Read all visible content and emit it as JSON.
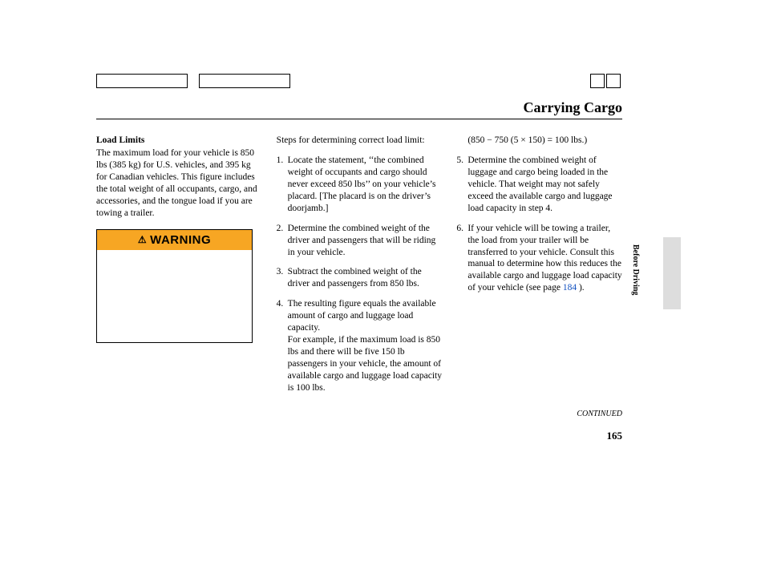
{
  "header": {
    "title": "Carrying Cargo"
  },
  "col1": {
    "subheading": "Load Limits",
    "para1": "The maximum load for your vehicle is 850 lbs (385 kg) for U.S. vehicles, and 395 kg for Canadian vehicles. This figure includes the total weight of all occupants, cargo, and accessories, and the tongue load if you are towing a trailer.",
    "warning_label": "WARNING"
  },
  "col2": {
    "intro": "Steps for determining correct load limit:",
    "items": [
      {
        "num": "1.",
        "text": "Locate the statement, ‘‘the combined weight of occupants and cargo should never exceed 850 lbs’’ on your vehicle’s placard. [The placard is on the driver’s doorjamb.]"
      },
      {
        "num": "2.",
        "text": "Determine the combined weight of the driver and passengers that will be riding in your vehicle."
      },
      {
        "num": "3.",
        "text": "Subtract the combined weight of the driver and passengers from 850 lbs."
      },
      {
        "num": "4.",
        "text": "The resulting figure equals the available amount of cargo and luggage load capacity.\nFor example, if the maximum load is 850 lbs and there will be five 150 lb passengers in your vehicle, the amount of available cargo and luggage load capacity is 100 lbs."
      }
    ]
  },
  "col3": {
    "calc": "(850 − 750 (5 × 150) = 100 lbs.)",
    "items": [
      {
        "num": "5.",
        "text": "Determine the combined weight of luggage and cargo being loaded in the vehicle. That weight may not safely exceed the available cargo and luggage load capacity in step 4."
      },
      {
        "num": "6.",
        "text_pre": "If your vehicle will be towing a trailer, the load from your trailer will be transferred to your vehicle. Consult this manual to determine how this reduces the available cargo and luggage load capacity of your vehicle (see page ",
        "link": "184",
        "text_post": " )."
      }
    ]
  },
  "side": {
    "label": "Before Driving"
  },
  "footer": {
    "continued": "CONTINUED",
    "page": "165"
  }
}
